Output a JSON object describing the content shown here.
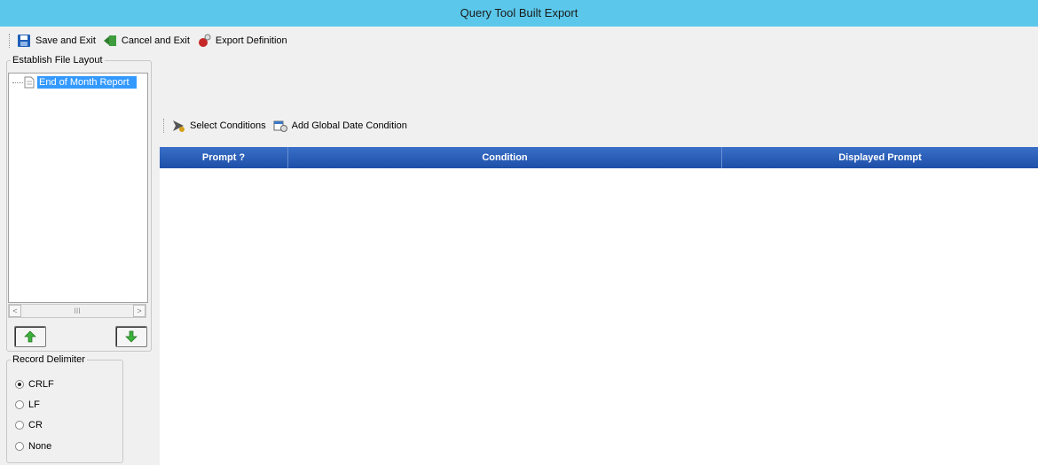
{
  "window": {
    "title": "Query Tool Built Export"
  },
  "toolbar": {
    "save_label": "Save and Exit",
    "cancel_label": "Cancel and Exit",
    "export_label": "Export Definition"
  },
  "layout": {
    "legend": "Establish File Layout",
    "tree_items": [
      {
        "label": "End of Month Report"
      }
    ]
  },
  "scrollbar": {
    "left": "<",
    "thumb": "III",
    "right": ">"
  },
  "delimiter": {
    "legend": "Record Delimiter",
    "options": [
      "CRLF",
      "LF",
      "CR",
      "None"
    ],
    "selected": "CRLF"
  },
  "conditions_toolbar": {
    "select_label": "Select Conditions",
    "add_global_label": "Add Global Date Condition"
  },
  "grid": {
    "columns": [
      "Prompt ?",
      "Condition",
      "Displayed Prompt"
    ],
    "rows": []
  },
  "colors": {
    "titlebar": "#5bc8eb",
    "grid_header": "#1d4fa8",
    "selection": "#3399ff"
  }
}
